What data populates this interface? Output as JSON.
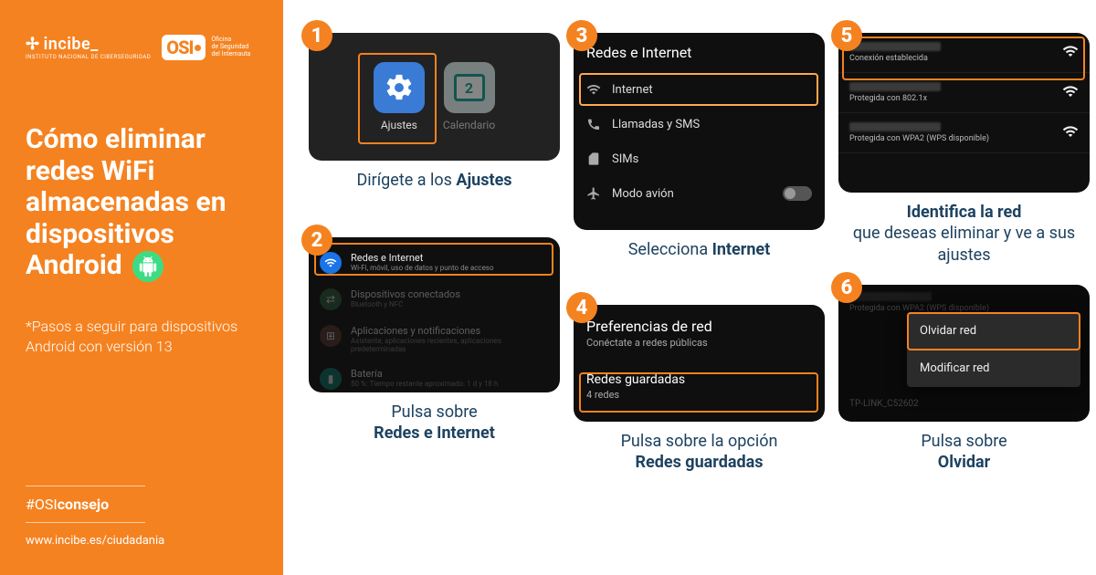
{
  "sidebar": {
    "logo_incibe": "incibe_",
    "logo_incibe_sub": "INSTITUTO NACIONAL DE CIBERSEGURIDAD",
    "logo_osi": "OSI",
    "logo_osi_sub_l1": "Oficina",
    "logo_osi_sub_l2": "de Seguridad",
    "logo_osi_sub_l3": "del Internauta",
    "title_l1": "Cómo eliminar redes WiFi almacenadas en dispositivos Android",
    "subtitle": "*Pasos a seguir para dispositivos Android con versión 13",
    "hashtag_prefix": "#OSI",
    "hashtag_bold": "consejo",
    "url": "www.incibe.es/ciudadania"
  },
  "steps": {
    "s1": {
      "num": "1",
      "app1": "Ajustes",
      "app2": "Calendario",
      "cal_day": "2",
      "caption_a": "Dirígete a los ",
      "caption_b": "Ajustes"
    },
    "s2": {
      "num": "2",
      "rows": [
        {
          "t1": "Redes e Internet",
          "t2": "Wi-Fi, móvil, uso de datos y punto de acceso"
        },
        {
          "t1": "Dispositivos conectados",
          "t2": "Bluetooth y NFC"
        },
        {
          "t1": "Aplicaciones y notificaciones",
          "t2": "Asistente, aplicaciones recientes, aplicaciones predeterminadas"
        },
        {
          "t1": "Batería",
          "t2": "50 %: Tiempo restante aproximado: 1 d y 18 h"
        }
      ],
      "caption_a": "Pulsa sobre",
      "caption_b": "Redes e Internet"
    },
    "s3": {
      "num": "3",
      "header": "Redes e Internet",
      "rows": [
        "Internet",
        "Llamadas y SMS",
        "SIMs",
        "Modo avión"
      ],
      "caption_a": "Selecciona ",
      "caption_b": "Internet"
    },
    "s4": {
      "num": "4",
      "pref_t": "Preferencias de red",
      "pref_s": "Conéctate a redes públicas",
      "saved_t": "Redes guardadas",
      "saved_s": "4 redes",
      "caption_a": "Pulsa sobre la opción",
      "caption_b": "Redes guardadas"
    },
    "s5": {
      "num": "5",
      "rows": [
        "Conexión establecida",
        "Protegida con 802.1x",
        "Protegida con WPA2 (WPS disponible)"
      ],
      "caption_b": "Identifica la red",
      "caption_a2": "que deseas eliminar y ve a sus ajustes"
    },
    "s6": {
      "num": "6",
      "bg1": "Protegida con WPA2 (WPS disponible)",
      "m1": "Olvidar red",
      "m2": "Modificar red",
      "bg2": "TP-LINK_C52602",
      "caption_a": "Pulsa sobre",
      "caption_b": "Olvidar"
    }
  }
}
